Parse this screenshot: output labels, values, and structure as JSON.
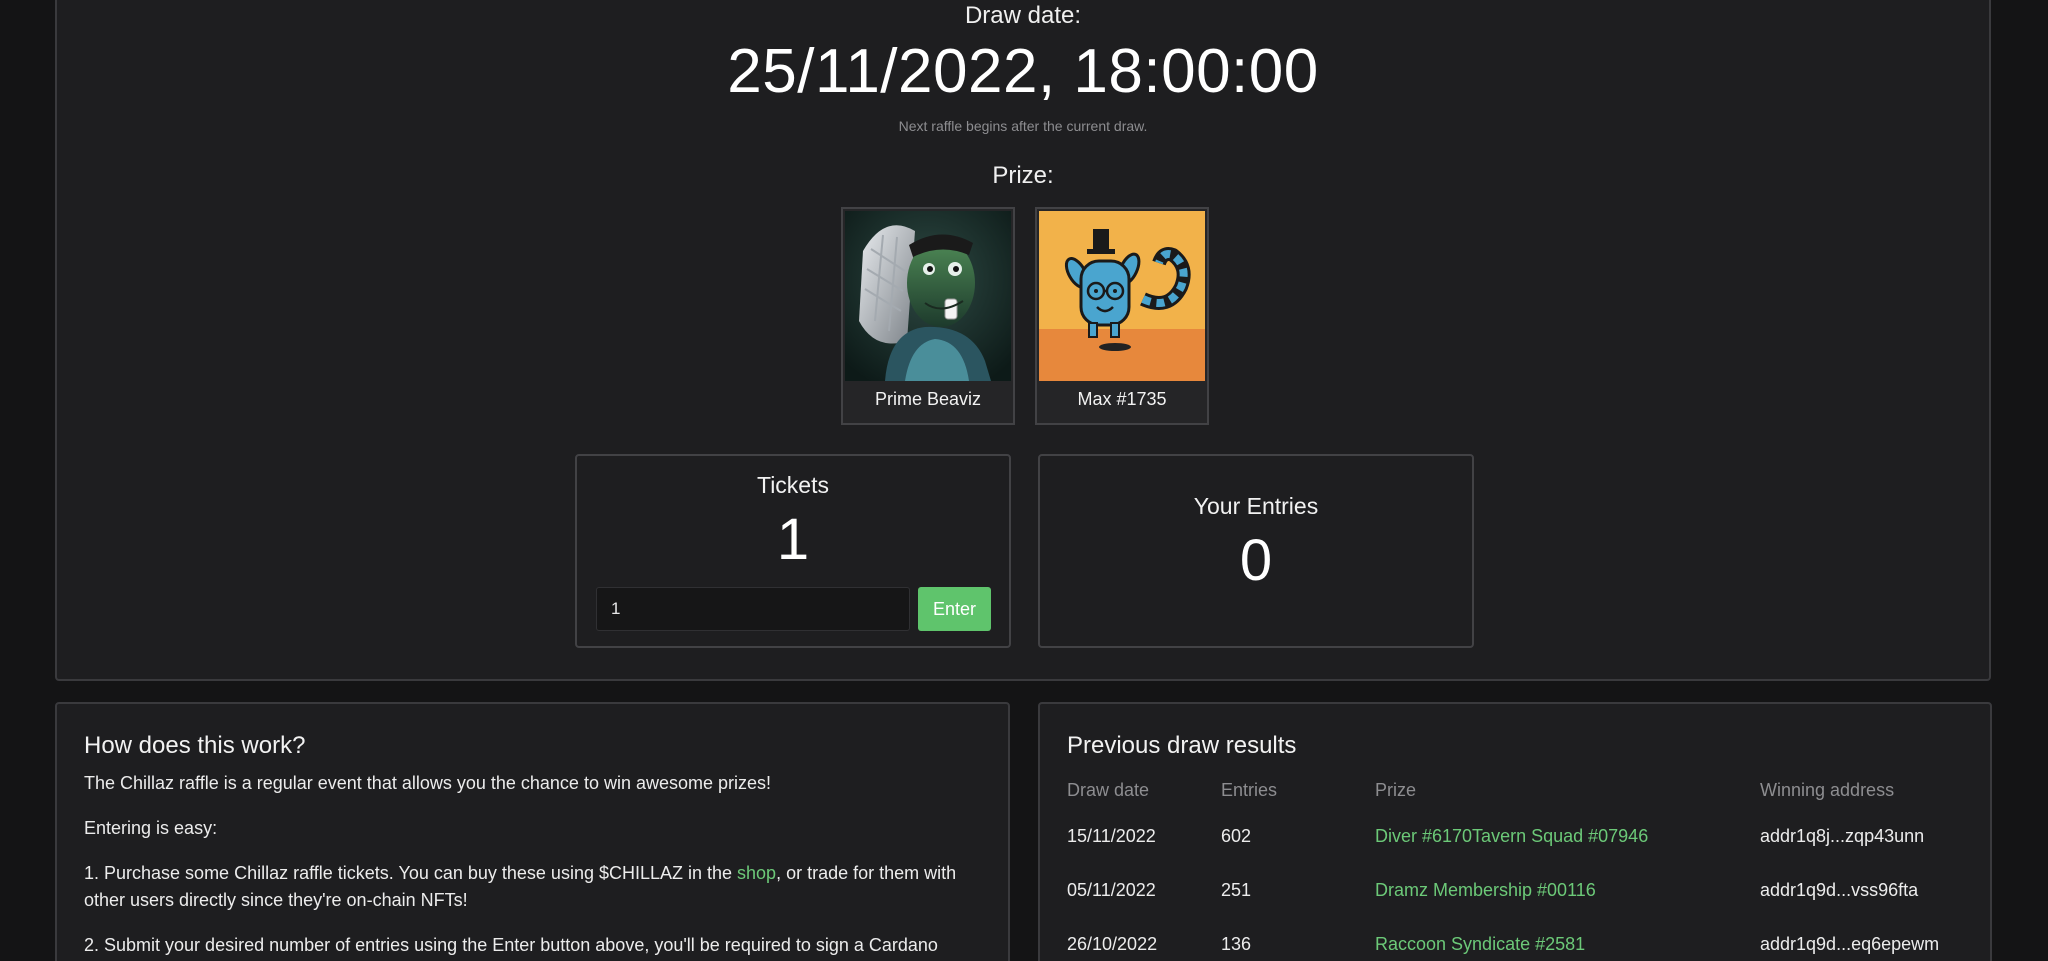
{
  "draw": {
    "label": "Draw date:",
    "date": "25/11/2022, 18:00:00",
    "note": "Next raffle begins after the current draw."
  },
  "prize": {
    "label": "Prize:",
    "items": [
      {
        "name": "Prime Beaviz"
      },
      {
        "name": "Max #1735"
      }
    ]
  },
  "tickets": {
    "title": "Tickets",
    "count": "1",
    "input_value": "1",
    "enter_label": "Enter"
  },
  "entries": {
    "title": "Your Entries",
    "count": "0"
  },
  "how": {
    "title": "How does this work?",
    "intro": "The Chillaz raffle is a regular event that allows you the chance to win awesome prizes!",
    "easy": "Entering is easy:",
    "step1_before": "1. Purchase some Chillaz raffle tickets. You can buy these using $CHILLAZ in the ",
    "step1_link": "shop",
    "step1_after": ", or trade for them with other users directly since they're on-chain NFTs!",
    "step2": "2. Submit your desired number of entries using the Enter button above, you'll be required to sign a Cardano"
  },
  "results": {
    "title": "Previous draw results",
    "columns": [
      "Draw date",
      "Entries",
      "Prize",
      "Winning address"
    ],
    "rows": [
      {
        "date": "15/11/2022",
        "entries": "602",
        "prize": "Diver #6170Tavern Squad #07946",
        "address": "addr1q8j...zqp43unn"
      },
      {
        "date": "05/11/2022",
        "entries": "251",
        "prize": "Dramz Membership #00116",
        "address": "addr1q9d...vss96fta"
      },
      {
        "date": "26/10/2022",
        "entries": "136",
        "prize": "Raccoon Syndicate #2581",
        "address": "addr1q9d...eq6epewm"
      }
    ]
  },
  "colors": {
    "accent": "#5fc46c",
    "link": "#6cc978",
    "background": "#141415",
    "panel": "#1e1e20"
  }
}
